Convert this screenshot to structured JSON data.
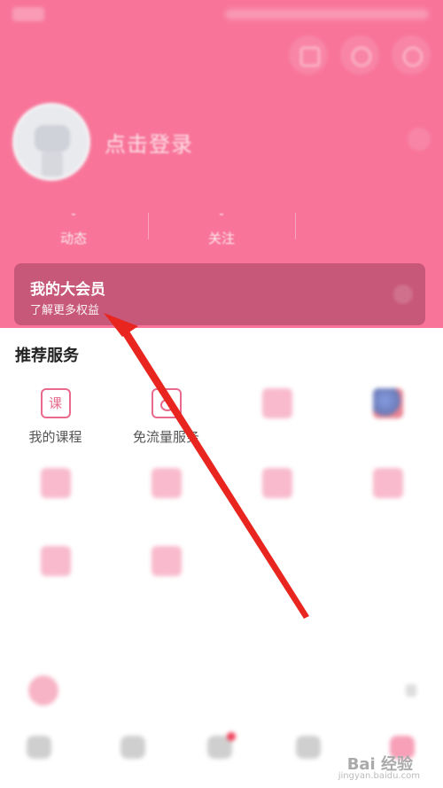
{
  "header": {
    "login_text": "点击登录",
    "stats": [
      {
        "value": "-",
        "label": "动态"
      },
      {
        "value": "-",
        "label": "关注"
      },
      {
        "value": "",
        "label": ""
      }
    ]
  },
  "vip": {
    "title": "我的大会员",
    "subtitle": "了解更多权益"
  },
  "services": {
    "section_title": "推荐服务",
    "items": [
      {
        "label": "我的课程",
        "icon": "course-icon",
        "glyph": "课"
      },
      {
        "label": "免流量服务",
        "icon": "free-data-icon"
      },
      {
        "label": "",
        "icon": "gift-icon"
      },
      {
        "label": "",
        "icon": "globe-icon"
      },
      {
        "label": "",
        "icon": "pink-icon"
      },
      {
        "label": "",
        "icon": "pink-icon"
      },
      {
        "label": "",
        "icon": "pink-icon"
      },
      {
        "label": "",
        "icon": "pink-icon"
      },
      {
        "label": "",
        "icon": "pink-icon"
      },
      {
        "label": "",
        "icon": "pink-icon"
      }
    ]
  },
  "more_services": {
    "section_title": "",
    "row_label": ""
  },
  "bottom_nav": {
    "items": [
      {
        "label": "",
        "icon": "home-icon"
      },
      {
        "label": "",
        "icon": "channel-icon"
      },
      {
        "label": "",
        "icon": "dynamic-icon"
      },
      {
        "label": "",
        "icon": "mall-icon"
      },
      {
        "label": "",
        "icon": "profile-icon"
      }
    ]
  },
  "watermark": {
    "text": "Bai 经验",
    "url": "jingyan.baidu.com"
  },
  "colors": {
    "header_bg": "#f87599",
    "vip_card_bg": "#c8587a",
    "accent": "#e96a8c",
    "arrow": "#e8261f"
  }
}
